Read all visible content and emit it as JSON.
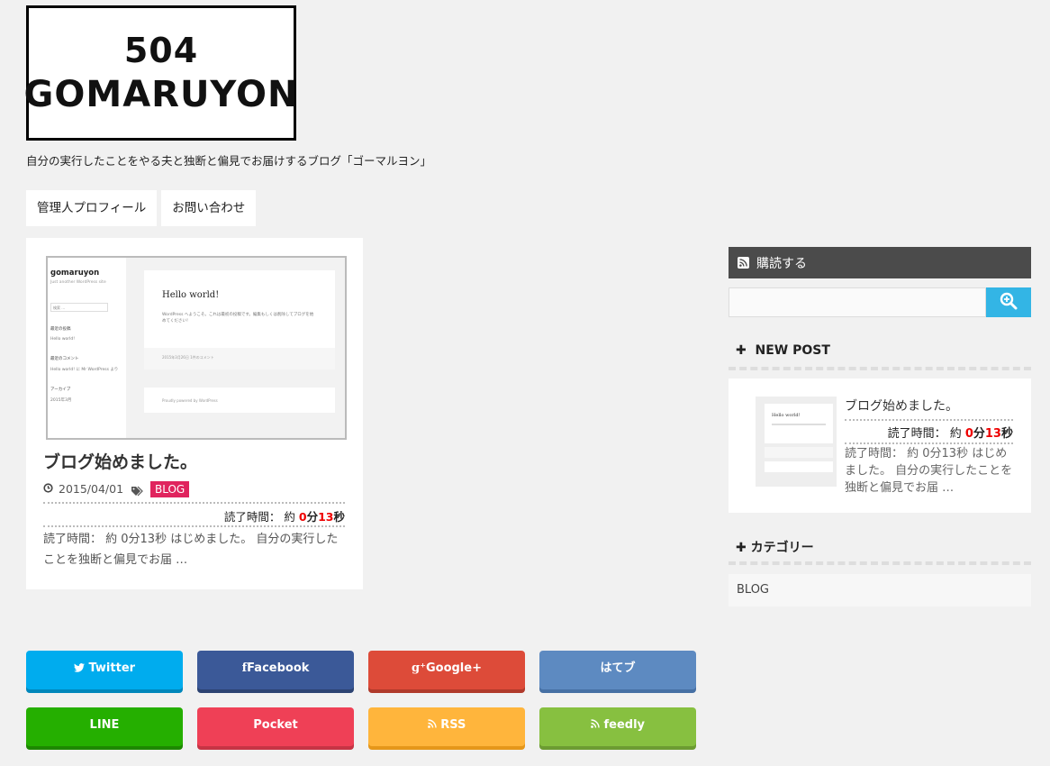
{
  "logo": {
    "line1": "504",
    "line2": "GOMARUYON"
  },
  "tagline": "自分の実行したことをやる夫と独断と偏見でお届けするブログ「ゴーマルヨン」",
  "nav": {
    "items": [
      {
        "label": "管理人プロフィール"
      },
      {
        "label": "お問い合わせ"
      }
    ]
  },
  "post": {
    "title": "ブログ始めました。",
    "date": "2015/04/01",
    "category": "BLOG",
    "read_prefix": "読了時間： 約 ",
    "read_min": "0",
    "read_min_unit": "分",
    "read_sec": "13",
    "read_sec_unit": "秒",
    "excerpt": "読了時間： 約 0分13秒 はじめました。 自分の実行したことを独断と偏見でお届 …",
    "thumbnail": {
      "site_title": "gomaruyon",
      "site_desc": "Just another WordPress site",
      "search": "検索 …",
      "recent_posts": "最近の投稿",
      "recent_item": "Hello world!",
      "recent_comments": "最近のコメント",
      "comment_item": "Hello world! に Mr WordPress より",
      "archives": "アーカイブ",
      "archive_item": "2015年3月",
      "post_title": "Hello world!",
      "post_body": "WordPress へようこそ。これは最初の投稿です。編集もしくは削除してブログを始めてください！",
      "post_meta": "2015年3月26日    1件のコメント",
      "footer": "Proudly powered by WordPress"
    }
  },
  "share": {
    "buttons": [
      {
        "label": "Twitter",
        "icon": "twitter-icon",
        "color": "#00acee",
        "shadow": "#0087bb"
      },
      {
        "label": "Facebook",
        "icon": "facebook-icon",
        "color": "#3b5998",
        "shadow": "#2c4372"
      },
      {
        "label": "Google+",
        "icon": "google-plus-icon",
        "color": "#dd4b39",
        "shadow": "#b03a2b"
      },
      {
        "label": "はてブ",
        "icon": "hatena-icon",
        "color": "#5d8ac1",
        "shadow": "#4670a4"
      },
      {
        "label": "LINE",
        "icon": "line-icon",
        "color": "#25af00",
        "shadow": "#1d8800"
      },
      {
        "label": "Pocket",
        "icon": "pocket-icon",
        "color": "#ef4056",
        "shadow": "#c63444"
      },
      {
        "label": "RSS",
        "icon": "rss-icon",
        "color": "#ffb53c",
        "shadow": "#e5971a"
      },
      {
        "label": "feedly",
        "icon": "feedly-icon",
        "color": "#87c040",
        "shadow": "#6c9c32"
      }
    ]
  },
  "sidebar": {
    "subscribe": "購読する",
    "search_placeholder": "",
    "new_post_title": "NEW POST",
    "new_post": {
      "title": "ブログ始めました。",
      "read_prefix": "読了時間： 約 ",
      "read_min": "0",
      "read_min_unit": "分",
      "read_sec": "13",
      "read_sec_unit": "秒",
      "excerpt": "読了時間： 約 0分13秒 はじめました。 自分の実行したことを独断と偏見でお届 …",
      "thumb_title": "Hello world!"
    },
    "category_title": "カテゴリー",
    "categories": [
      "BLOG"
    ]
  }
}
